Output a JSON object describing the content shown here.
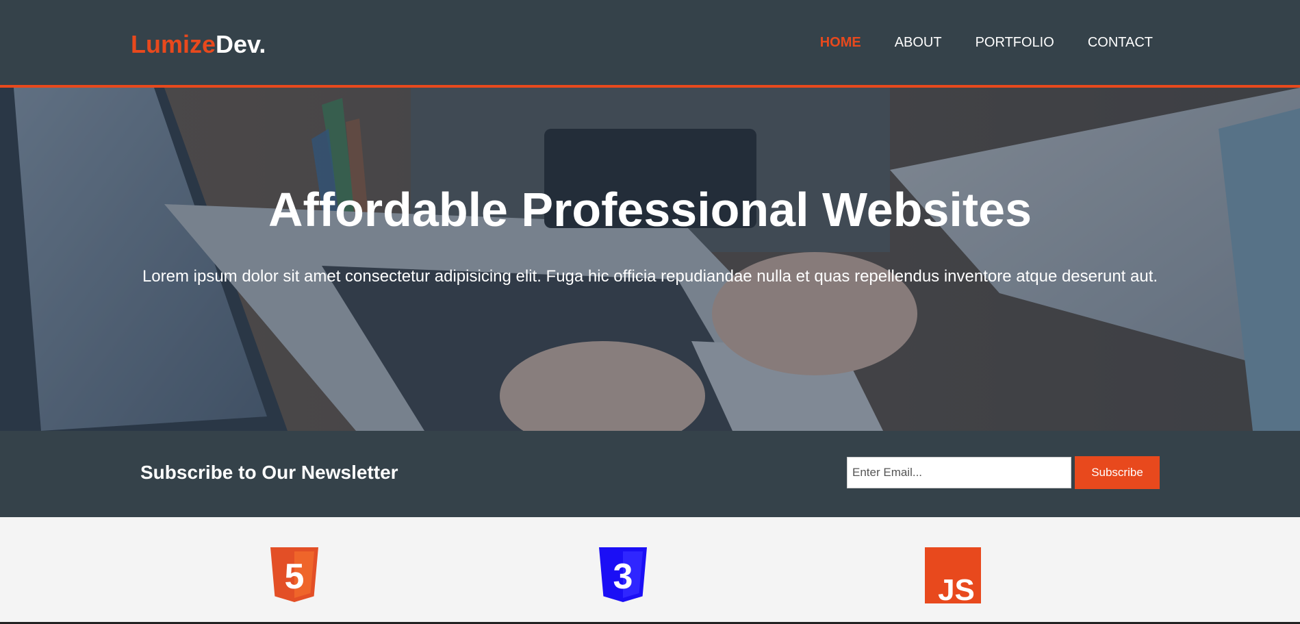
{
  "brand": {
    "highlight": "Lumize",
    "rest": "Dev."
  },
  "nav": {
    "items": [
      {
        "label": "HOME",
        "active": true
      },
      {
        "label": "ABOUT",
        "active": false
      },
      {
        "label": "PORTFOLIO",
        "active": false
      },
      {
        "label": "CONTACT",
        "active": false
      }
    ]
  },
  "hero": {
    "title": "Affordable Professional Websites",
    "text": "Lorem ipsum dolor sit amet consectetur adipisicing elit. Fuga hic officia repudiandae nulla et quas repellendus inventore atque deserunt aut."
  },
  "newsletter": {
    "title": "Subscribe to Our Newsletter",
    "email_placeholder": "Enter Email...",
    "button_label": "Subscribe"
  },
  "logos": {
    "html": {
      "icon": "html5-logo-icon",
      "digit": "5"
    },
    "css": {
      "icon": "css3-logo-icon",
      "digit": "3"
    },
    "js": {
      "icon": "javascript-logo-icon",
      "text": "JS"
    }
  },
  "colors": {
    "accent": "#e8491d",
    "header_bg": "#35424a",
    "body_bg": "#f4f4f4",
    "html5_orange": "#e34f26",
    "css3_blue": "#1b0ff5",
    "js_orange": "#e8491d"
  }
}
